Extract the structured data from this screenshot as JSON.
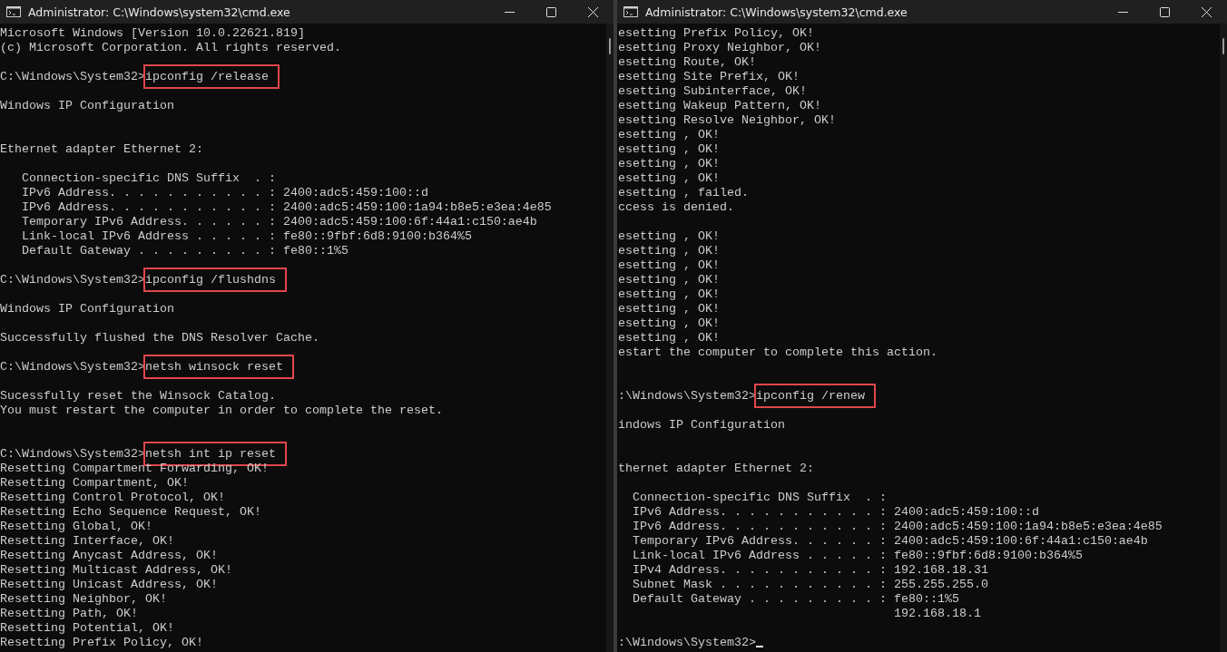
{
  "windows": [
    {
      "title": "Administrator: C:\\Windows\\system32\\cmd.exe",
      "lines": [
        {
          "kind": "text",
          "text": "Microsoft Windows [Version 10.0.22621.819]"
        },
        {
          "kind": "text",
          "text": "(c) Microsoft Corporation. All rights reserved."
        },
        {
          "kind": "blank"
        },
        {
          "kind": "prompt",
          "prompt": "C:\\Windows\\System32>",
          "command": "ipconfig /release",
          "highlighted": true
        },
        {
          "kind": "blank"
        },
        {
          "kind": "text",
          "text": "Windows IP Configuration"
        },
        {
          "kind": "blank"
        },
        {
          "kind": "blank"
        },
        {
          "kind": "text",
          "text": "Ethernet adapter Ethernet 2:"
        },
        {
          "kind": "blank"
        },
        {
          "kind": "text",
          "text": "   Connection-specific DNS Suffix  . :"
        },
        {
          "kind": "text",
          "text": "   IPv6 Address. . . . . . . . . . . : 2400:adc5:459:100::d"
        },
        {
          "kind": "text",
          "text": "   IPv6 Address. . . . . . . . . . . : 2400:adc5:459:100:1a94:b8e5:e3ea:4e85"
        },
        {
          "kind": "text",
          "text": "   Temporary IPv6 Address. . . . . . : 2400:adc5:459:100:6f:44a1:c150:ae4b"
        },
        {
          "kind": "text",
          "text": "   Link-local IPv6 Address . . . . . : fe80::9fbf:6d8:9100:b364%5"
        },
        {
          "kind": "text",
          "text": "   Default Gateway . . . . . . . . . : fe80::1%5"
        },
        {
          "kind": "blank"
        },
        {
          "kind": "prompt",
          "prompt": "C:\\Windows\\System32>",
          "command": "ipconfig /flushdns",
          "highlighted": true
        },
        {
          "kind": "blank"
        },
        {
          "kind": "text",
          "text": "Windows IP Configuration"
        },
        {
          "kind": "blank"
        },
        {
          "kind": "text",
          "text": "Successfully flushed the DNS Resolver Cache."
        },
        {
          "kind": "blank"
        },
        {
          "kind": "prompt",
          "prompt": "C:\\Windows\\System32>",
          "command": "netsh winsock reset",
          "highlighted": true
        },
        {
          "kind": "blank"
        },
        {
          "kind": "text",
          "text": "Sucessfully reset the Winsock Catalog."
        },
        {
          "kind": "text",
          "text": "You must restart the computer in order to complete the reset."
        },
        {
          "kind": "blank"
        },
        {
          "kind": "blank"
        },
        {
          "kind": "prompt",
          "prompt": "C:\\Windows\\System32>",
          "command": "netsh int ip reset",
          "highlighted": true
        },
        {
          "kind": "text",
          "text": "Resetting Compartment Forwarding, OK!"
        },
        {
          "kind": "text",
          "text": "Resetting Compartment, OK!"
        },
        {
          "kind": "text",
          "text": "Resetting Control Protocol, OK!"
        },
        {
          "kind": "text",
          "text": "Resetting Echo Sequence Request, OK!"
        },
        {
          "kind": "text",
          "text": "Resetting Global, OK!"
        },
        {
          "kind": "text",
          "text": "Resetting Interface, OK!"
        },
        {
          "kind": "text",
          "text": "Resetting Anycast Address, OK!"
        },
        {
          "kind": "text",
          "text": "Resetting Multicast Address, OK!"
        },
        {
          "kind": "text",
          "text": "Resetting Unicast Address, OK!"
        },
        {
          "kind": "text",
          "text": "Resetting Neighbor, OK!"
        },
        {
          "kind": "text",
          "text": "Resetting Path, OK!"
        },
        {
          "kind": "text",
          "text": "Resetting Potential, OK!"
        },
        {
          "kind": "text",
          "text": "Resetting Prefix Policy, OK!"
        }
      ]
    },
    {
      "title": "Administrator: C:\\Windows\\system32\\cmd.exe",
      "lines": [
        {
          "kind": "text",
          "text": "esetting Prefix Policy, OK!"
        },
        {
          "kind": "text",
          "text": "esetting Proxy Neighbor, OK!"
        },
        {
          "kind": "text",
          "text": "esetting Route, OK!"
        },
        {
          "kind": "text",
          "text": "esetting Site Prefix, OK!"
        },
        {
          "kind": "text",
          "text": "esetting Subinterface, OK!"
        },
        {
          "kind": "text",
          "text": "esetting Wakeup Pattern, OK!"
        },
        {
          "kind": "text",
          "text": "esetting Resolve Neighbor, OK!"
        },
        {
          "kind": "text",
          "text": "esetting , OK!"
        },
        {
          "kind": "text",
          "text": "esetting , OK!"
        },
        {
          "kind": "text",
          "text": "esetting , OK!"
        },
        {
          "kind": "text",
          "text": "esetting , OK!"
        },
        {
          "kind": "text",
          "text": "esetting , failed."
        },
        {
          "kind": "text",
          "text": "ccess is denied."
        },
        {
          "kind": "blank"
        },
        {
          "kind": "text",
          "text": "esetting , OK!"
        },
        {
          "kind": "text",
          "text": "esetting , OK!"
        },
        {
          "kind": "text",
          "text": "esetting , OK!"
        },
        {
          "kind": "text",
          "text": "esetting , OK!"
        },
        {
          "kind": "text",
          "text": "esetting , OK!"
        },
        {
          "kind": "text",
          "text": "esetting , OK!"
        },
        {
          "kind": "text",
          "text": "esetting , OK!"
        },
        {
          "kind": "text",
          "text": "esetting , OK!"
        },
        {
          "kind": "text",
          "text": "estart the computer to complete this action."
        },
        {
          "kind": "blank"
        },
        {
          "kind": "blank"
        },
        {
          "kind": "prompt",
          "prompt": ":\\Windows\\System32>",
          "command": "ipconfig /renew",
          "highlighted": true
        },
        {
          "kind": "blank"
        },
        {
          "kind": "text",
          "text": "indows IP Configuration"
        },
        {
          "kind": "blank"
        },
        {
          "kind": "blank"
        },
        {
          "kind": "text",
          "text": "thernet adapter Ethernet 2:"
        },
        {
          "kind": "blank"
        },
        {
          "kind": "text",
          "text": "  Connection-specific DNS Suffix  . :"
        },
        {
          "kind": "text",
          "text": "  IPv6 Address. . . . . . . . . . . : 2400:adc5:459:100::d"
        },
        {
          "kind": "text",
          "text": "  IPv6 Address. . . . . . . . . . . : 2400:adc5:459:100:1a94:b8e5:e3ea:4e85"
        },
        {
          "kind": "text",
          "text": "  Temporary IPv6 Address. . . . . . : 2400:adc5:459:100:6f:44a1:c150:ae4b"
        },
        {
          "kind": "text",
          "text": "  Link-local IPv6 Address . . . . . : fe80::9fbf:6d8:9100:b364%5"
        },
        {
          "kind": "text",
          "text": "  IPv4 Address. . . . . . . . . . . : 192.168.18.31"
        },
        {
          "kind": "text",
          "text": "  Subnet Mask . . . . . . . . . . . : 255.255.255.0"
        },
        {
          "kind": "text",
          "text": "  Default Gateway . . . . . . . . . : fe80::1%5"
        },
        {
          "kind": "text",
          "text": "                                      192.168.18.1"
        },
        {
          "kind": "blank"
        },
        {
          "kind": "input",
          "prompt": ":\\Windows\\System32>"
        }
      ]
    }
  ]
}
